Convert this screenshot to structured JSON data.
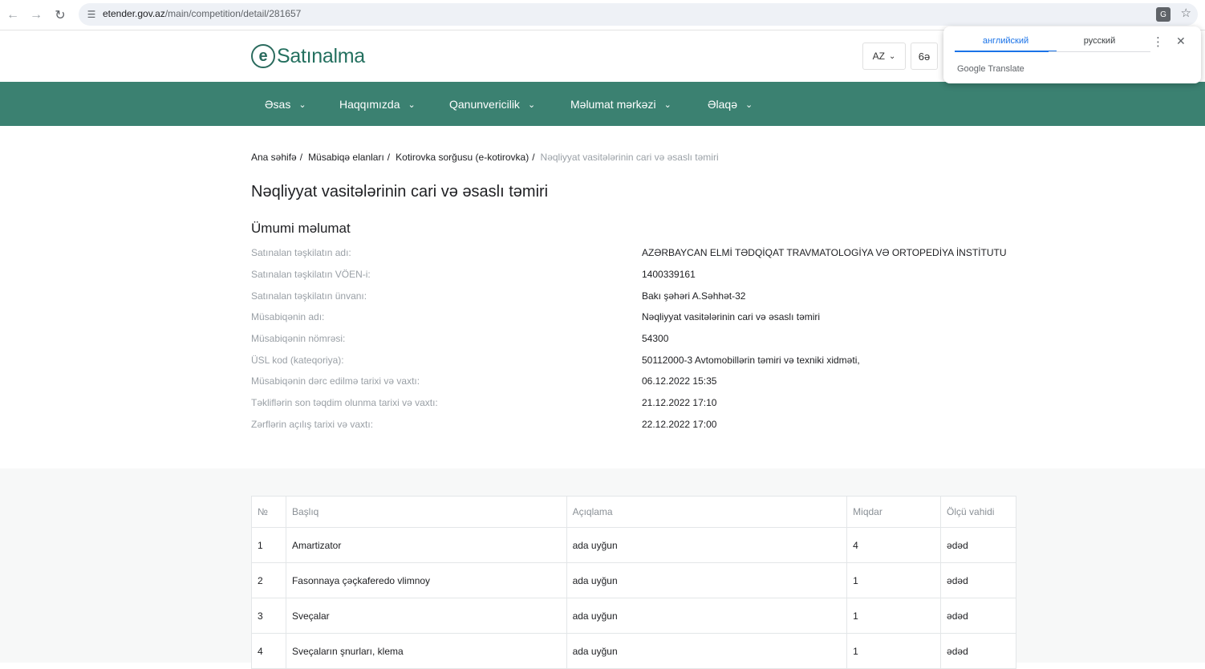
{
  "browser": {
    "url_host": "etender.gov.az",
    "url_path": "/main/competition/detail/281657"
  },
  "translate_popup": {
    "tab_english": "английский",
    "tab_russian": "русский",
    "brand": "Google Translate"
  },
  "header": {
    "logo_text": "Satınalma",
    "lang": "AZ",
    "accessibility": "6ə"
  },
  "menu": [
    {
      "label": "Əsas"
    },
    {
      "label": "Haqqımızda"
    },
    {
      "label": "Qanunvericilik"
    },
    {
      "label": "Məlumat mərkəzi"
    },
    {
      "label": "Əlaqə"
    }
  ],
  "breadcrumb": [
    "Ana səhifə",
    "Müsabiqə elanları",
    "Kotirovka sorğusu (e-kotirovka)",
    "Nəqliyyat vasitələrinin cari və əsaslı təmiri"
  ],
  "page_title": "Nəqliyyat vasitələrinin cari və əsaslı təmiri",
  "general_info": {
    "title": "Ümumi məlumat",
    "rows": [
      {
        "label": "Satınalan təşkilatın adı:",
        "value": "AZƏRBAYCAN ELMİ TƏDQİQAT TRAVMATOLOGİYA VƏ ORTOPEDİYA İNSTİTUTU"
      },
      {
        "label": "Satınalan təşkilatın VÖEN-i:",
        "value": "1400339161"
      },
      {
        "label": "Satınalan təşkilatın ünvanı:",
        "value": "Bakı şəhəri A.Səhhət-32"
      },
      {
        "label": "Müsabiqənin adı:",
        "value": "Nəqliyyat vasitələrinin cari və əsaslı təmiri"
      },
      {
        "label": "Müsabiqənin nömrəsi:",
        "value": "54300"
      },
      {
        "label": "ÜSL kod (kateqoriya):",
        "value": "50112000-3 Avtomobillərin təmiri və texniki xidməti,"
      },
      {
        "label": "Müsabiqənin dərc edilmə tarixi və vaxtı:",
        "value": "06.12.2022 15:35"
      },
      {
        "label": "Təkliflərin son təqdim olunma tarixi və vaxtı:",
        "value": "21.12.2022 17:10"
      },
      {
        "label": "Zərflərin açılış tarixi və vaxtı:",
        "value": "22.12.2022 17:00"
      }
    ]
  },
  "items_table": {
    "headers": [
      "№",
      "Başlıq",
      "Açıqlama",
      "Miqdar",
      "Ölçü vahidi"
    ],
    "rows": [
      [
        "1",
        "Amartizator",
        "ada uyğun",
        "4",
        "ədəd"
      ],
      [
        "2",
        "Fasonnaya çəçkaferedo vlimnoy",
        "ada uyğun",
        "1",
        "ədəd"
      ],
      [
        "3",
        "Sveçalar",
        "ada uyğun",
        "1",
        "ədəd"
      ],
      [
        "4",
        "Sveçaların şnurları, klema",
        "ada uyğun",
        "1",
        "ədəd"
      ]
    ]
  }
}
